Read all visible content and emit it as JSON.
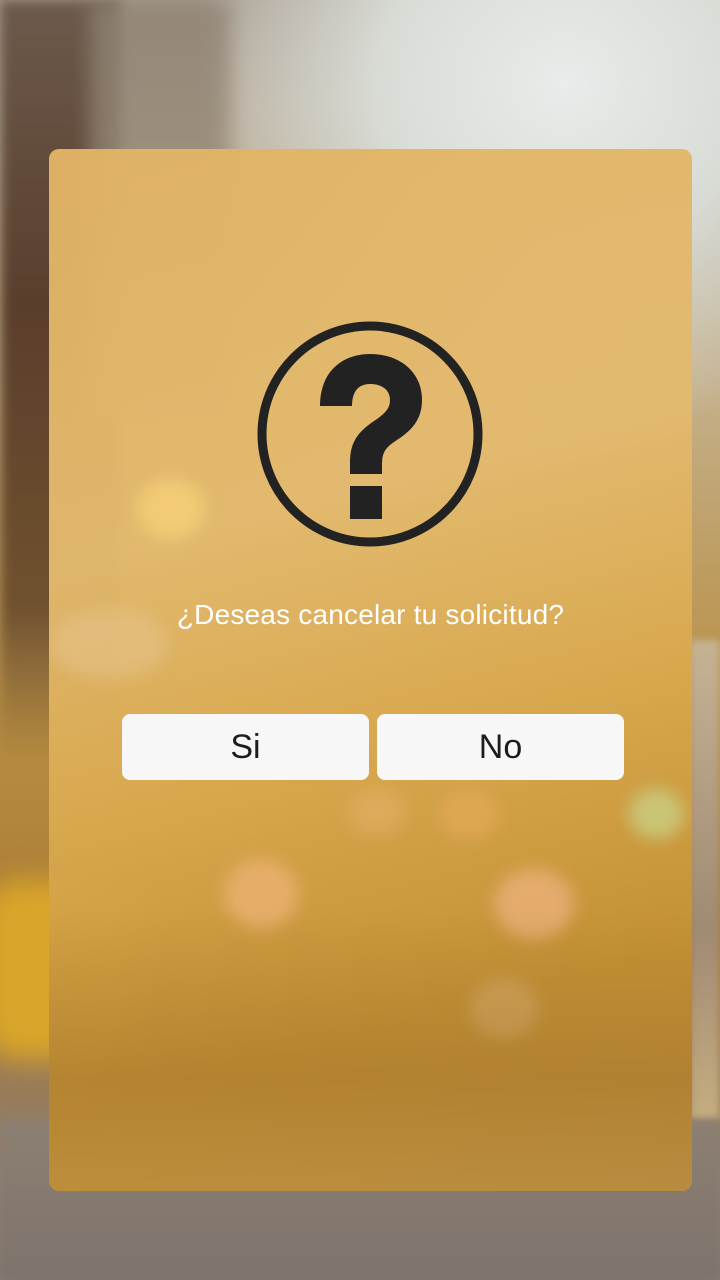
{
  "dialog": {
    "icon": "question-mark-circle-icon",
    "prompt": "¿Deseas cancelar tu solicitud?",
    "yes_label": "Si",
    "no_label": "No"
  },
  "colors": {
    "panel": "#e2b464",
    "button_bg": "#f7f7f7",
    "button_text": "#1c1c1c",
    "icon": "#222222",
    "prompt_text": "#ffffff"
  }
}
